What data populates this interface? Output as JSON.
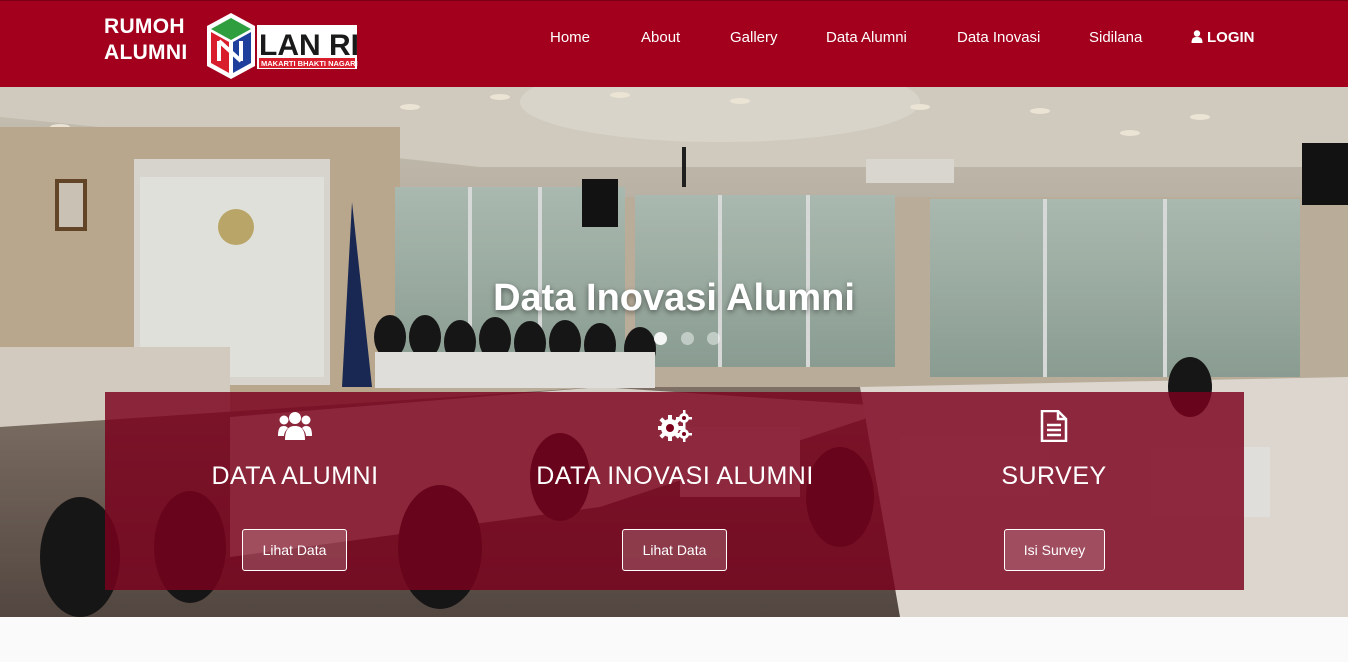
{
  "brand": {
    "line1": "RUMOH",
    "line2": "ALUMNI",
    "logo_text": "LAN RI",
    "logo_tagline": "MAKARTI BHAKTI NAGARI"
  },
  "nav": {
    "home": "Home",
    "about": "About",
    "gallery": "Gallery",
    "data_alumni": "Data Alumni",
    "data_inovasi": "Data Inovasi",
    "sidilana": "Sidilana",
    "login": "LOGIN"
  },
  "hero": {
    "title": "Data Inovasi Alumni",
    "slide_count": 3,
    "active_slide": 1
  },
  "cards": [
    {
      "title": "DATA ALUMNI",
      "icon": "users-icon",
      "button": "Lihat Data"
    },
    {
      "title": "DATA INOVASI ALUMNI",
      "icon": "gears-icon",
      "button": "Lihat Data"
    },
    {
      "title": "SURVEY",
      "icon": "document-icon",
      "button": "Isi Survey"
    }
  ],
  "colors": {
    "brand_red": "#a2001d",
    "panel_red": "#7a001c"
  }
}
